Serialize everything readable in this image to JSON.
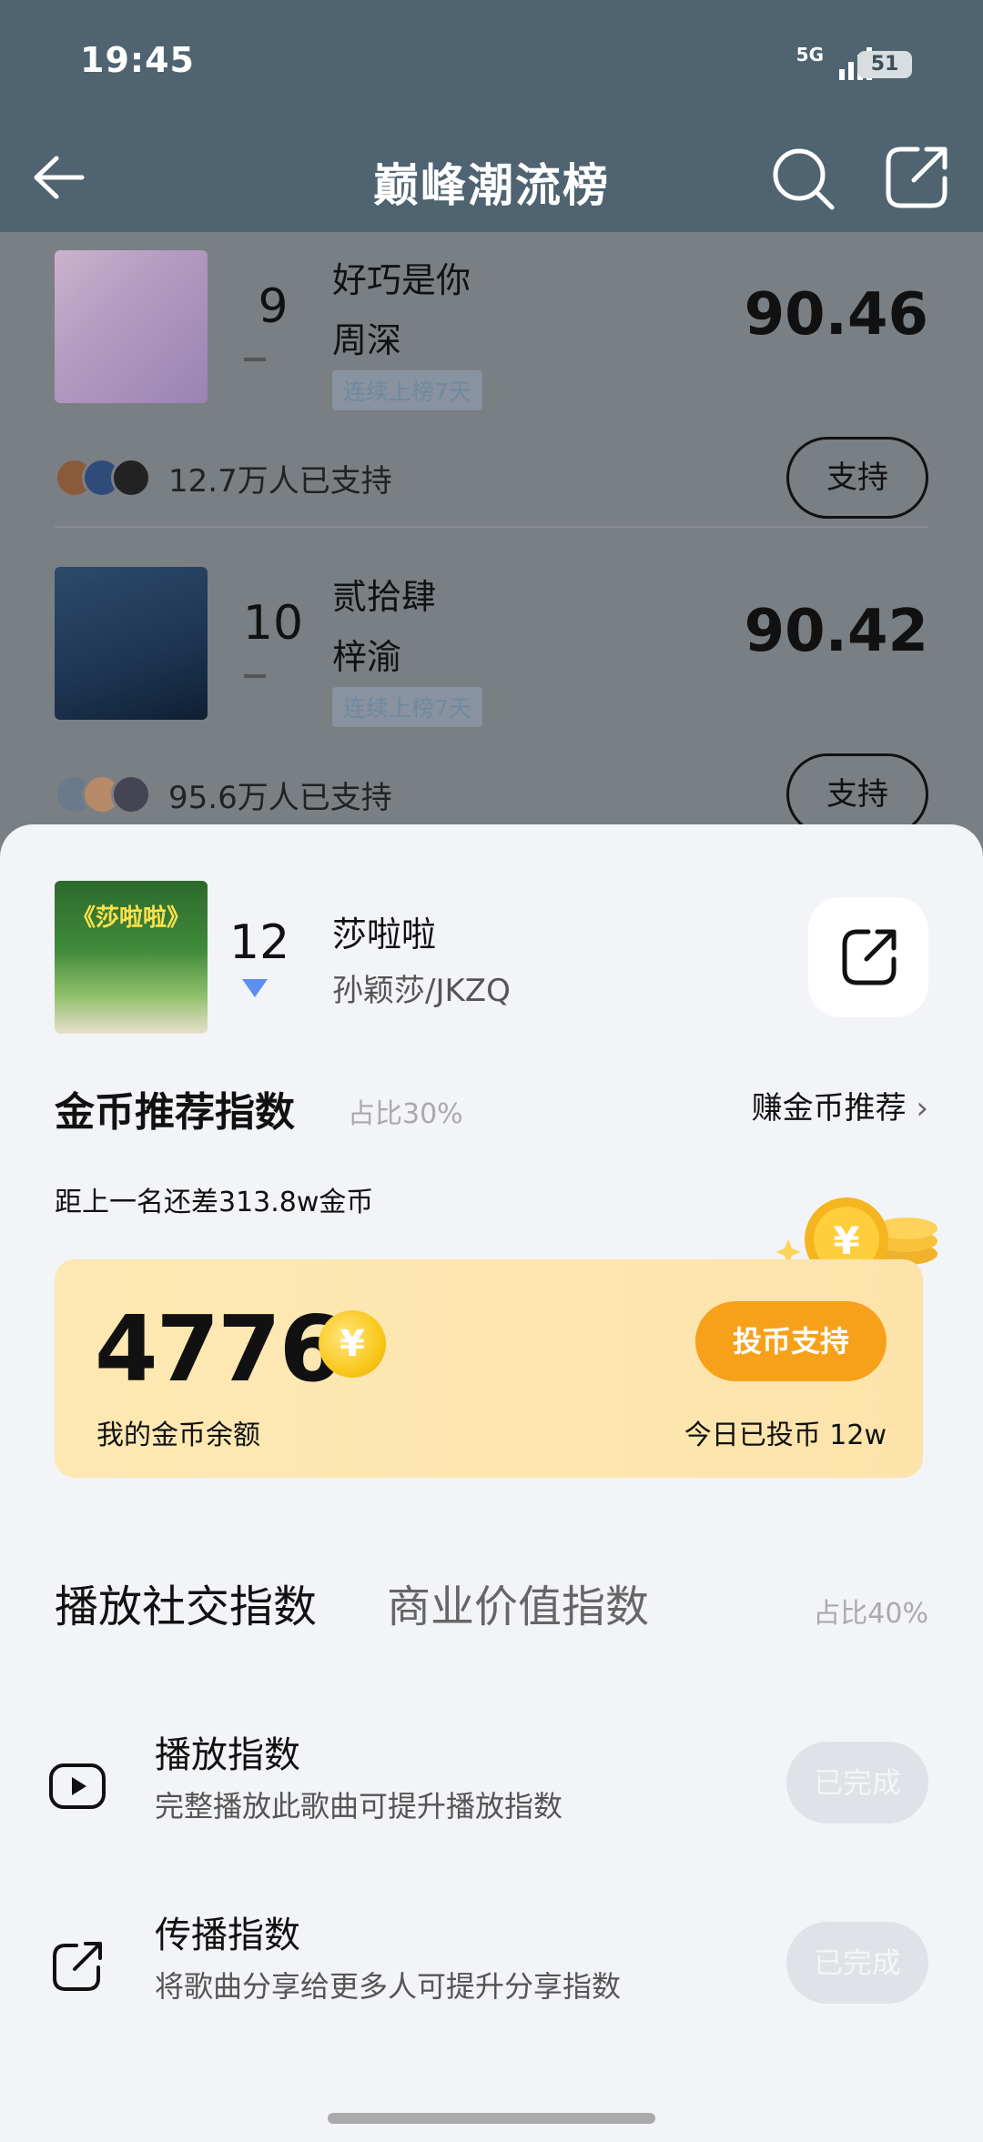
{
  "status": {
    "time": "19:45",
    "network": "5G",
    "battery": "51"
  },
  "header": {
    "title": "巅峰潮流榜"
  },
  "list": [
    {
      "rank": "9",
      "song": "好巧是你",
      "artist": "周深",
      "tag": "连续上榜7天",
      "score": "90.46",
      "supporters": "12.7万人已支持",
      "support_label": "支持"
    },
    {
      "rank": "10",
      "song": "贰拾肆",
      "artist": "梓渝",
      "tag": "连续上榜7天",
      "score": "90.42",
      "supporters": "95.6万人已支持",
      "support_label": "支持"
    }
  ],
  "current": {
    "rank": "12",
    "song": "莎啦啦",
    "artist": "孙颖莎/JKZQ",
    "cover_title": "《莎啦啦》"
  },
  "coin": {
    "title": "金币推荐指数",
    "ratio": "占比30%",
    "earn_label": "赚金币推荐",
    "gap_text": "距上一名还差313.8w金币",
    "balance": "4776",
    "coin_symbol": "¥",
    "balance_label": "我的金币余额",
    "vote_label": "投币支持",
    "today_text": "今日已投币 12w"
  },
  "tabs": {
    "active": "播放社交指数",
    "inactive": "商业价值指数",
    "ratio": "占比40%"
  },
  "tasks": [
    {
      "title": "播放指数",
      "desc": "完整播放此歌曲可提升播放指数",
      "status": "已完成",
      "icon": "play-icon"
    },
    {
      "title": "传播指数",
      "desc": "将歌曲分享给更多人可提升分享指数",
      "status": "已完成",
      "icon": "share-icon"
    }
  ],
  "colors": {
    "header_bg": "#4f6371",
    "accent_green": "#1ec86d",
    "vote_orange": "#f7a11a",
    "rank_down": "#5b8ff0"
  }
}
